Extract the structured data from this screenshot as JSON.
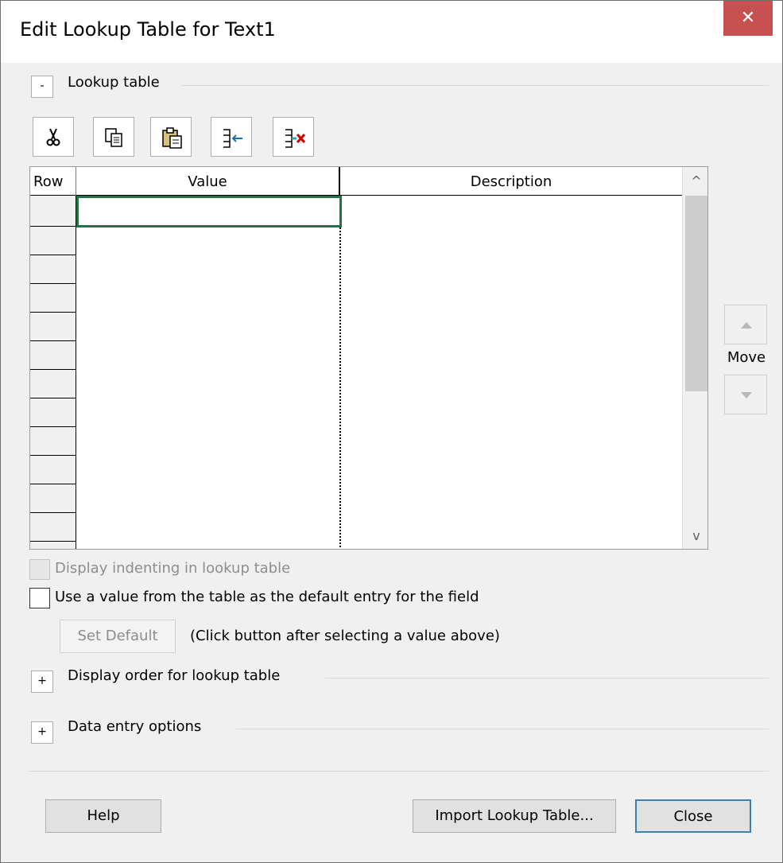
{
  "window": {
    "title": "Edit Lookup Table for Text1",
    "close_glyph": "✕"
  },
  "lookup_section": {
    "toggle": "-",
    "label": "Lookup table"
  },
  "toolbar": {
    "buttons": [
      {
        "name": "cut",
        "icon": "scissors-icon"
      },
      {
        "name": "copy",
        "icon": "copy-icon"
      },
      {
        "name": "paste",
        "icon": "paste-icon"
      },
      {
        "name": "insert-row",
        "icon": "insert-row-icon"
      },
      {
        "name": "delete-row",
        "icon": "delete-row-icon"
      }
    ]
  },
  "grid": {
    "columns": [
      "Row",
      "Value",
      "Description"
    ],
    "rows": [],
    "scroll_up_glyph": "^",
    "scroll_down_glyph": "v"
  },
  "move": {
    "label": "Move"
  },
  "options": {
    "display_indenting": "Display indenting in lookup table",
    "use_default": "Use a value from the table as the default entry for the field",
    "set_default_button": "Set Default",
    "hint": "(Click button after selecting a value above)"
  },
  "display_order_section": {
    "toggle": "+",
    "label": "Display order for lookup table"
  },
  "data_entry_section": {
    "toggle": "+",
    "label": "Data entry options"
  },
  "footer": {
    "help_button": "Help",
    "import_button": "Import Lookup Table...",
    "close_button": "Close"
  },
  "colors": {
    "active_cell_border": "#217346",
    "close_button_bg": "#c75050",
    "default_button_border": "#3c7fb1"
  }
}
